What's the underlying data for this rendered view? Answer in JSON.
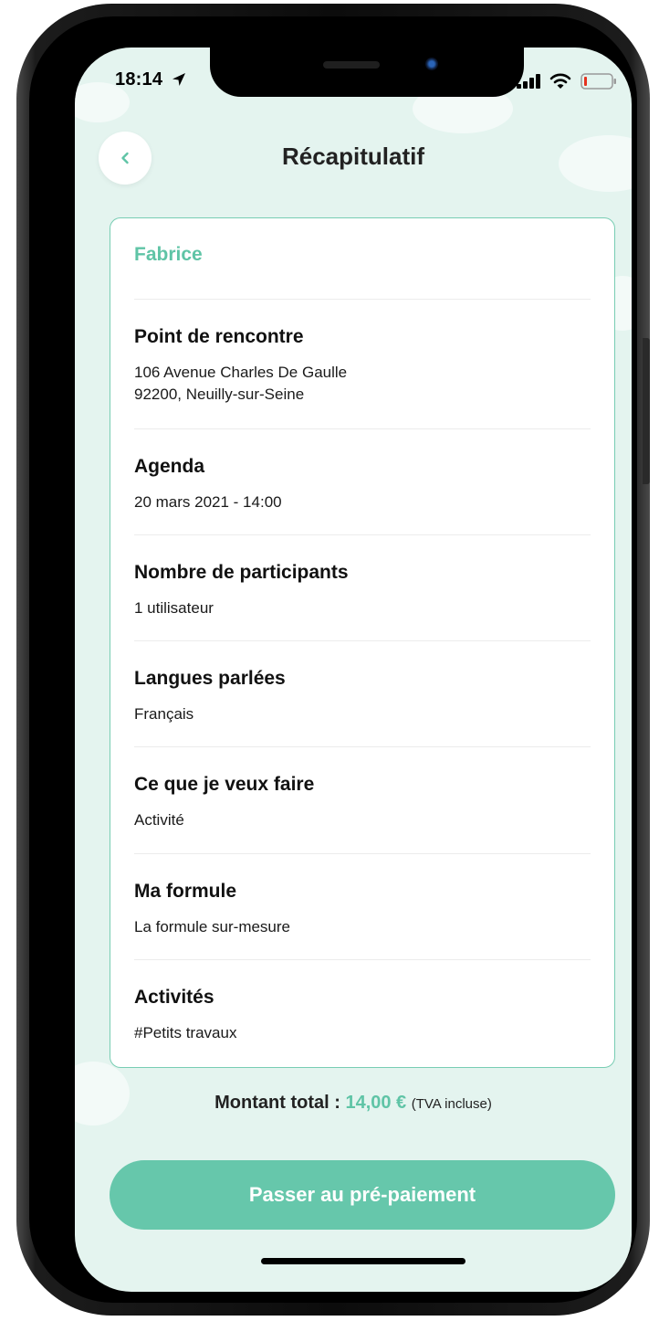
{
  "status_bar": {
    "time": "18:14"
  },
  "header": {
    "title": "Récapitulatif",
    "back_icon": "chevron-left-icon"
  },
  "summary": {
    "guide_name": "Fabrice",
    "sections": [
      {
        "title": "Point de rencontre",
        "lines": [
          "106 Avenue Charles De Gaulle",
          "92200, Neuilly-sur-Seine"
        ]
      },
      {
        "title": "Agenda",
        "lines": [
          "20 mars 2021 - 14:00"
        ]
      },
      {
        "title": "Nombre de participants",
        "lines": [
          "1 utilisateur"
        ]
      },
      {
        "title": "Langues parlées",
        "lines": [
          "Français"
        ]
      },
      {
        "title": "Ce que je veux faire",
        "lines": [
          "Activité"
        ]
      },
      {
        "title": "Ma formule",
        "lines": [
          "La formule sur-mesure"
        ]
      },
      {
        "title": "Activités",
        "lines": [
          "#Petits travaux"
        ]
      }
    ]
  },
  "total": {
    "label": "Montant total :",
    "amount": "14,00 €",
    "tax_note": "(TVA incluse)"
  },
  "cta": {
    "label": "Passer au pré-paiement"
  },
  "colors": {
    "accent": "#5fc4a6",
    "button": "#66c7ab",
    "background": "#e4f4ef",
    "card_border": "#78cdb3"
  }
}
